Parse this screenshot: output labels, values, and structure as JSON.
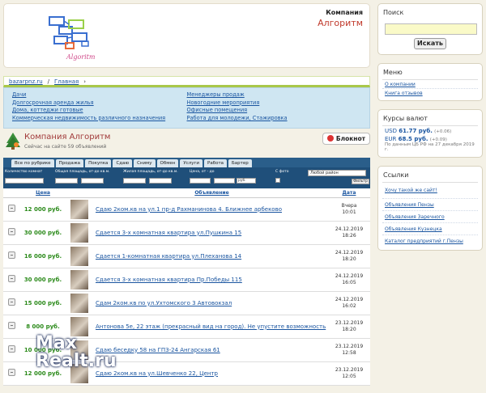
{
  "header": {
    "company_label": "Компания",
    "company_name": "Алгоритм",
    "logo_text": "Algoritm"
  },
  "breadcrumb": [
    "bazarpnz.ru",
    "/",
    "Главная",
    "›"
  ],
  "categories": {
    "left": [
      "Дачи",
      "Долгосрочная аренда жилья",
      "Дома, коттеджи готовые",
      "Коммерческая недвижимость различного назначения"
    ],
    "right": [
      "Менеджеры продаж",
      "Новогодние мероприятия",
      "Офисные помещения",
      "Работа для молодежи, Стажировка"
    ]
  },
  "company": {
    "title": "Компания Алгоритм",
    "subtitle": "Сейчас на сайте 59 объявлений",
    "notebook": "Блокнот"
  },
  "tabs": [
    "Все по рубрике",
    "Продажа",
    "Покупка",
    "Сдаю",
    "Сниму",
    "Обмен",
    "Услуги",
    "Работа",
    "Бартер"
  ],
  "filters": {
    "rooms": "Количество комнат",
    "area": "Общая площадь, от-до кв.м.",
    "living": "Жилая площадь, от-до кв.м.",
    "price": "Цена, от - до",
    "currency": "руб.",
    "photo": "С фото",
    "district": "Любой район",
    "button": "Фильтр"
  },
  "table": {
    "headers": {
      "price": "Цена",
      "ad": "Объявление",
      "date": "Дата"
    },
    "rows": [
      {
        "price": "12 000 руб.",
        "text": "Сдаю 2ком.кв на ул.1 пр-д Рахманинова 4. Ближнее арбеково",
        "date1": "Вчера",
        "date2": "10:01"
      },
      {
        "price": "30 000 руб.",
        "text": "Сдается 3-х комнатная квартира ул.Пушкина 15",
        "date1": "24.12.2019",
        "date2": "18:26"
      },
      {
        "price": "16 000 руб.",
        "text": "Сдается 1-комнатная квартира ул.Плеханова 14",
        "date1": "24.12.2019",
        "date2": "18:20"
      },
      {
        "price": "30 000 руб.",
        "text": "Сдается 3-х комнатная квартира Пр.Победы 115",
        "date1": "24.12.2019",
        "date2": "16:05"
      },
      {
        "price": "15 000 руб.",
        "text": "Сдам 2ком.кв по ул.Ухтомского 3 Автовокзал",
        "date1": "24.12.2019",
        "date2": "16:02"
      },
      {
        "price": "8 000 руб.",
        "text": "Антонова 5е, 22 этаж (прекрасный вид на город). Не упустите возможность",
        "date1": "23.12.2019",
        "date2": "18:20"
      },
      {
        "price": "10 000 руб.",
        "text": "Сдаю беседку 58 на ГПЗ-24 Ангарская 61",
        "date1": "23.12.2019",
        "date2": "12:58"
      },
      {
        "price": "12 000 руб.",
        "text": "Сдаю 2ком.кв на ул.Шевченко 22, Центр",
        "date1": "23.12.2019",
        "date2": "12:05"
      }
    ]
  },
  "sidebar": {
    "search_title": "Поиск",
    "search_button": "Искать",
    "menu_title": "Меню",
    "menu": [
      "О компании",
      "Книга отзывов"
    ],
    "rates_title": "Курсы валют",
    "rates": [
      {
        "code": "USD",
        "value": "61.77 руб.",
        "delta": "(+0.06)"
      },
      {
        "code": "EUR",
        "value": "68.5 руб.",
        "delta": "(+0.09)"
      }
    ],
    "rates_note": "По данным ЦБ РФ на 27 декабря 2019 г.",
    "links_title": "Ссылки",
    "want": "Хочу такой же сайт!",
    "links": [
      "Объявления Пензы",
      "Объявления Заречного",
      "Объявления Кузнецка",
      "Каталог предприятий г.Пензы"
    ]
  },
  "watermark": {
    "line1": "Max",
    "line2": "Realt.ru"
  }
}
